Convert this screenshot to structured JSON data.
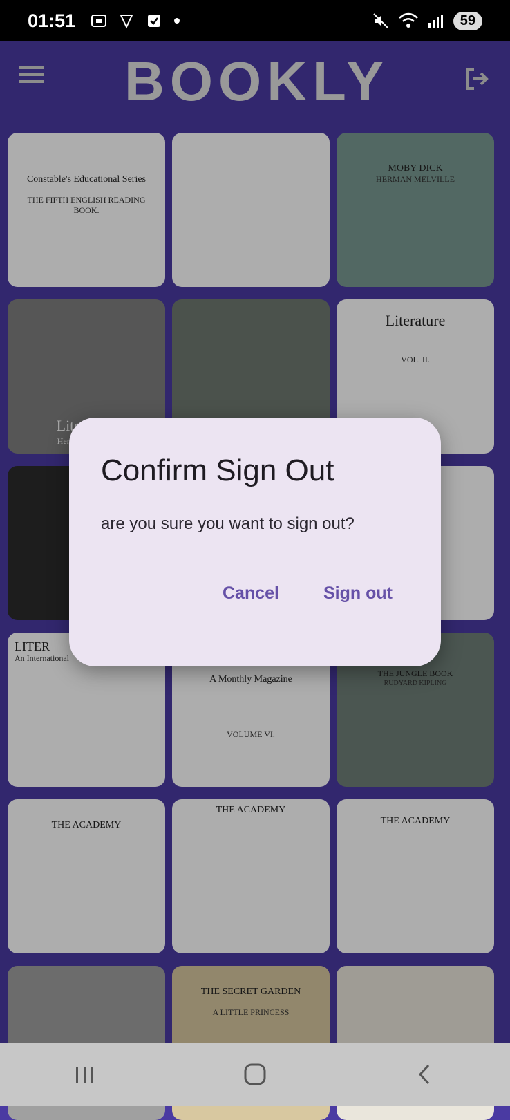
{
  "status": {
    "time": "01:51",
    "battery": "59"
  },
  "app": {
    "logo": "BOOKLY"
  },
  "books": [
    {
      "title": "Constable's Educational Series",
      "subtitle": "THE FIFTH ENGLISH READING BOOK."
    },
    {
      "title": "",
      "subtitle": ""
    },
    {
      "title": "MOBY DICK",
      "subtitle": "HERMAN MELVILLE"
    },
    {
      "title": "Literature",
      "subtitle": "Henry Duff Traill"
    },
    {
      "title": "",
      "subtitle": ""
    },
    {
      "title": "Literature",
      "subtitle": "VOL. II."
    },
    {
      "title": "",
      "subtitle": ""
    },
    {
      "title": "",
      "subtitle": ""
    },
    {
      "title": "",
      "subtitle": ""
    },
    {
      "title": "LITER",
      "subtitle": "An International"
    },
    {
      "title": "A Monthly Magazine",
      "subtitle": "VOLUME VI."
    },
    {
      "title": "THE JUNGLE BOOK",
      "subtitle": "RUDYARD KIPLING"
    },
    {
      "title": "THE ACADEMY",
      "subtitle": ""
    },
    {
      "title": "THE ACADEMY",
      "subtitle": ""
    },
    {
      "title": "THE ACADEMY",
      "subtitle": ""
    },
    {
      "title": "",
      "subtitle": ""
    },
    {
      "title": "THE SECRET GARDEN",
      "subtitle": "A LITTLE PRINCESS"
    },
    {
      "title": "",
      "subtitle": ""
    }
  ],
  "dialog": {
    "title": "Confirm Sign Out",
    "message": "are you sure you want to sign out?",
    "cancel": "Cancel",
    "sign_out": "Sign out"
  }
}
